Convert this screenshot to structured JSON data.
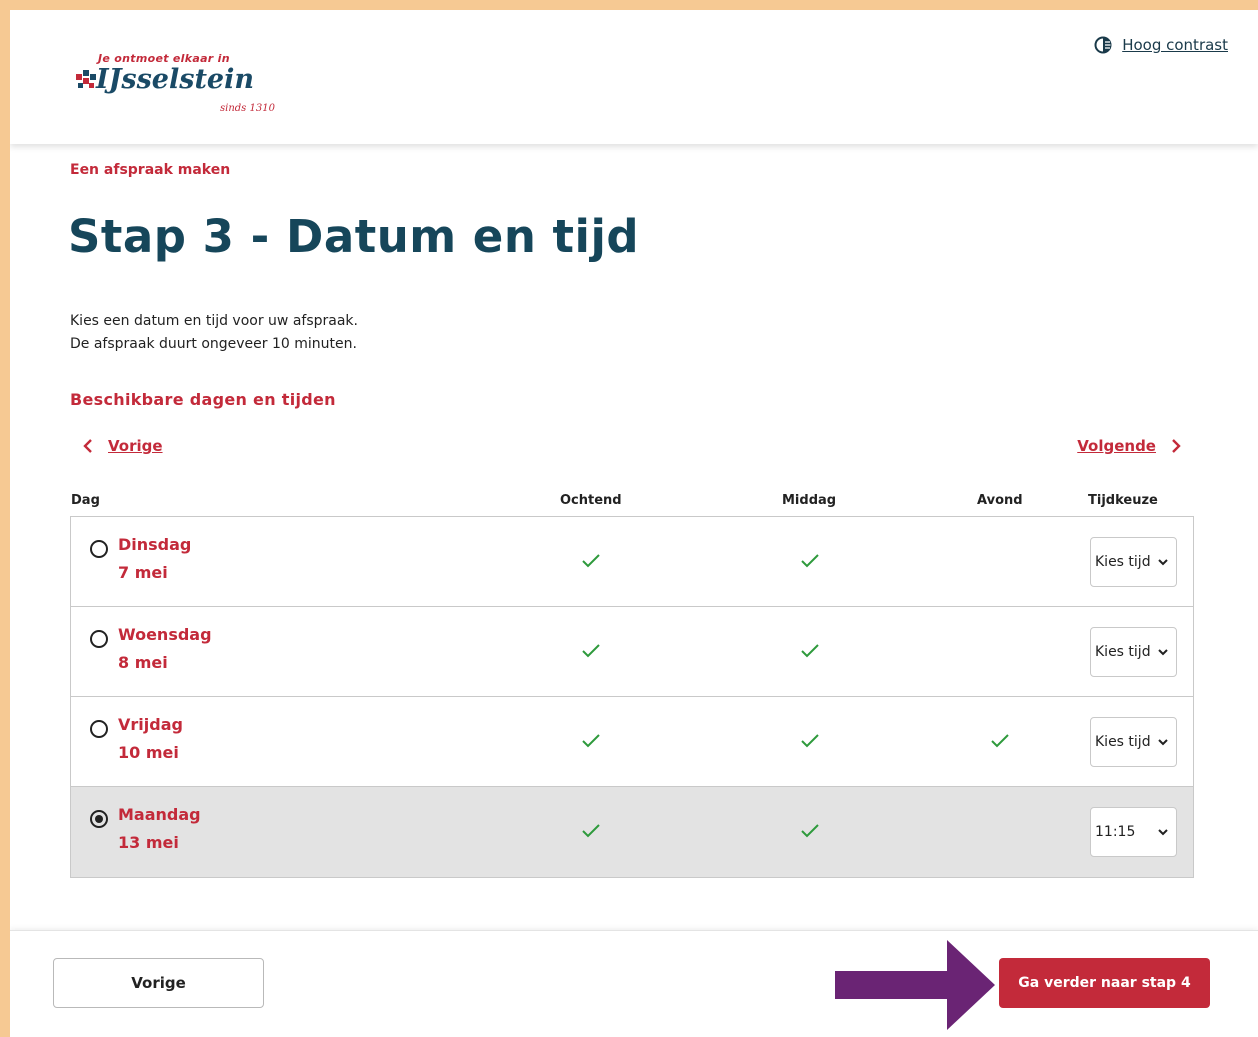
{
  "header": {
    "logo_tagline": "Je ontmoet elkaar in",
    "logo_name": "IJsselstein",
    "logo_since": "sinds 1310",
    "contrast_label": "Hoog contrast"
  },
  "breadcrumb": "Een afspraak maken",
  "title": "Stap 3 - Datum en tijd",
  "intro": {
    "line1": "Kies een datum en tijd voor uw afspraak.",
    "line2": "De afspraak duurt ongeveer 10 minuten."
  },
  "section_title": "Beschikbare dagen en tijden",
  "nav": {
    "prev": "Vorige",
    "next": "Volgende"
  },
  "table": {
    "headers": {
      "day": "Dag",
      "morning": "Ochtend",
      "afternoon": "Middag",
      "evening": "Avond",
      "time": "Tijdkeuze"
    },
    "rows": [
      {
        "day": "Dinsdag",
        "date": "7 mei",
        "morning": true,
        "afternoon": true,
        "evening": false,
        "time": "Kies tijd",
        "selected": false
      },
      {
        "day": "Woensdag",
        "date": "8 mei",
        "morning": true,
        "afternoon": true,
        "evening": false,
        "time": "Kies tijd",
        "selected": false
      },
      {
        "day": "Vrijdag",
        "date": "10 mei",
        "morning": true,
        "afternoon": true,
        "evening": true,
        "time": "Kies tijd",
        "selected": false
      },
      {
        "day": "Maandag",
        "date": "13 mei",
        "morning": true,
        "afternoon": true,
        "evening": false,
        "time": "11:15",
        "selected": true
      }
    ]
  },
  "footer": {
    "prev_label": "Vorige",
    "next_label": "Ga verder naar stap 4"
  },
  "colors": {
    "accent": "#c32a3a",
    "title": "#16465a",
    "frame": "#f6c993",
    "arrow": "#6a2474",
    "selected_row": "#e3e3e3",
    "check": "#2e9a3c"
  }
}
